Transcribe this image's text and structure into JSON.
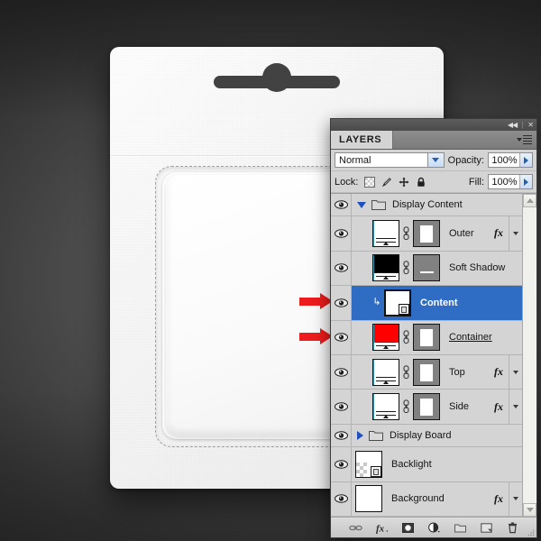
{
  "panel": {
    "title": "LAYERS",
    "titlebar": {
      "collapse_icon": "collapse-double-arrow-icon",
      "close_icon": "close-icon"
    },
    "menu_icon": "panel-menu-icon",
    "blend_mode": {
      "label": "Normal",
      "icon": "chevron-down-icon"
    },
    "opacity": {
      "label": "Opacity:",
      "value": "100%"
    },
    "fill": {
      "label": "Fill:",
      "value": "100%"
    },
    "lock": {
      "label": "Lock:",
      "items": [
        {
          "name": "lock-transparent-pixels-icon"
        },
        {
          "name": "lock-image-pixels-icon"
        },
        {
          "name": "lock-position-icon"
        },
        {
          "name": "lock-all-icon"
        }
      ]
    },
    "layers": [
      {
        "name": "Display Content",
        "kind": "group",
        "expanded": true,
        "visible": true,
        "selected": false,
        "indent": 0,
        "thumb": "none",
        "mask": false,
        "link": false,
        "fx": false,
        "clipped": false,
        "smart_object": false,
        "underline": false
      },
      {
        "name": "Outer",
        "kind": "layer",
        "visible": true,
        "selected": false,
        "indent": 1,
        "thumb": "white-doc",
        "mask": "frame",
        "link": true,
        "fx": true,
        "clipped": false,
        "smart_object": false,
        "underline": false
      },
      {
        "name": "Soft Shadow",
        "kind": "layer",
        "visible": true,
        "selected": false,
        "indent": 1,
        "thumb": "black-doc",
        "mask": "line",
        "link": true,
        "fx": false,
        "clipped": false,
        "smart_object": false,
        "underline": false
      },
      {
        "name": "Content",
        "kind": "layer",
        "visible": true,
        "selected": true,
        "indent": 1,
        "thumb": "white-corner",
        "mask": false,
        "link": false,
        "fx": false,
        "clipped": true,
        "smart_object": true,
        "underline": false
      },
      {
        "name": "Container",
        "kind": "layer",
        "visible": true,
        "selected": false,
        "indent": 1,
        "thumb": "red-doc",
        "mask": "frame",
        "link": true,
        "fx": false,
        "clipped": false,
        "smart_object": false,
        "underline": true
      },
      {
        "name": "Top",
        "kind": "layer",
        "visible": true,
        "selected": false,
        "indent": 1,
        "thumb": "white-doc",
        "mask": "frame",
        "link": true,
        "fx": true,
        "clipped": false,
        "smart_object": false,
        "underline": false
      },
      {
        "name": "Side",
        "kind": "layer",
        "visible": true,
        "selected": false,
        "indent": 1,
        "thumb": "white-doc",
        "mask": "frame",
        "link": true,
        "fx": true,
        "clipped": false,
        "smart_object": false,
        "underline": false
      },
      {
        "name": "Display Board",
        "kind": "group",
        "expanded": false,
        "visible": true,
        "selected": false,
        "indent": 0,
        "thumb": "none",
        "mask": false,
        "link": false,
        "fx": false,
        "clipped": false,
        "smart_object": false,
        "underline": false
      },
      {
        "name": "Backlight",
        "kind": "layer",
        "visible": true,
        "selected": false,
        "indent": 0,
        "thumb": "transparent-corner",
        "mask": false,
        "link": false,
        "fx": false,
        "clipped": false,
        "smart_object": true,
        "underline": false
      },
      {
        "name": "Background",
        "kind": "layer",
        "visible": true,
        "selected": false,
        "indent": 0,
        "thumb": "plain-white",
        "mask": false,
        "link": false,
        "fx": true,
        "clipped": false,
        "smart_object": false,
        "underline": false
      }
    ],
    "footer_buttons": [
      {
        "name": "link-layers-icon"
      },
      {
        "name": "layer-style-fx-icon"
      },
      {
        "name": "add-layer-mask-icon"
      },
      {
        "name": "new-adjustment-layer-icon"
      },
      {
        "name": "new-group-icon"
      },
      {
        "name": "new-layer-icon"
      },
      {
        "name": "delete-layer-icon"
      }
    ],
    "scrollbar": {
      "up_icon": "scroll-up-icon",
      "down_icon": "scroll-down-icon"
    }
  },
  "annotations": {
    "arrows": [
      {
        "name": "arrow-pointing-content-layer",
        "target": "Content"
      },
      {
        "name": "arrow-pointing-container-layer",
        "target": "Container"
      }
    ]
  },
  "colors": {
    "selection_blue": "#2f6cc4",
    "panel_background": "#d4d4d4",
    "arrow_red": "#ee1c1c",
    "thumbnail_red": "#fe0000",
    "canvas_dark": "#3a3a3a"
  }
}
